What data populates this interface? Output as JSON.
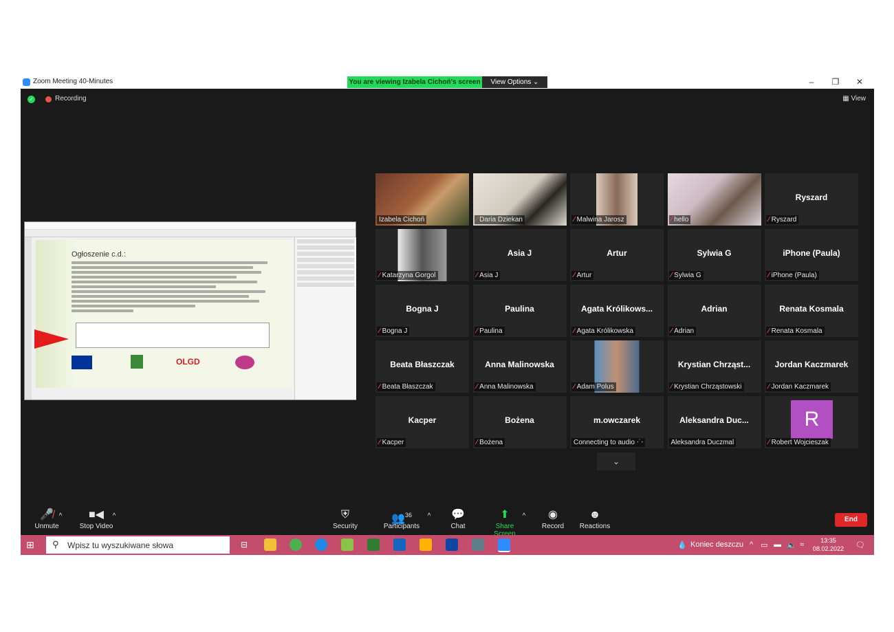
{
  "window": {
    "title": "Zoom Meeting 40-Minutes",
    "viewing_banner": "You are viewing Izabela Cichoń's screen",
    "view_options": "View Options ⌄",
    "minimize": "–",
    "restore": "❐",
    "close": "✕"
  },
  "header": {
    "recording": "Recording",
    "view": "View"
  },
  "shared_screen": {
    "slide_heading": "Ogłoszenie c.d.:",
    "logo_text": "OLGD"
  },
  "tiles": [
    {
      "label": "Izabela Cichoń",
      "muted": false,
      "video": true,
      "active": true
    },
    {
      "label": "Daria Dziekan",
      "muted": true,
      "video": true
    },
    {
      "label": "Malwina Jarosz",
      "muted": true,
      "video": true
    },
    {
      "label": "hello",
      "muted": true,
      "video": true
    },
    {
      "name": "Ryszard",
      "label": "Ryszard",
      "muted": true
    },
    {
      "label": "Katarzyna Gorgol",
      "muted": true,
      "video": true
    },
    {
      "name": "Asia J",
      "label": "Asia J",
      "muted": true
    },
    {
      "name": "Artur",
      "label": "Artur",
      "muted": true
    },
    {
      "name": "Sylwia G",
      "label": "Sylwia G",
      "muted": true
    },
    {
      "name": "iPhone (Paula)",
      "label": "iPhone (Paula)",
      "muted": true
    },
    {
      "name": "Bogna J",
      "label": "Bogna J",
      "muted": true
    },
    {
      "name": "Paulina",
      "label": "Paulina",
      "muted": true
    },
    {
      "name": "Agata Królikows...",
      "label": "Agata Królikowska",
      "muted": true
    },
    {
      "name": "Adrian",
      "label": "Adrian",
      "muted": true
    },
    {
      "name": "Renata Kosmala",
      "label": "Renata Kosmala",
      "muted": true
    },
    {
      "name": "Beata Błaszczak",
      "label": "Beata Błaszczak",
      "muted": true
    },
    {
      "name": "Anna Malinowska",
      "label": "Anna Malinowska",
      "muted": true
    },
    {
      "label": "Adam Polus",
      "muted": true,
      "video": true
    },
    {
      "name": "Krystian Chrząst...",
      "label": "Krystian Chrząstowski",
      "muted": true
    },
    {
      "name": "Jordan Kaczmarek",
      "label": "Jordan Kaczmarek",
      "muted": true
    },
    {
      "name": "Kacper",
      "label": "Kacper",
      "muted": true
    },
    {
      "name": "Bożena",
      "label": "Bożena",
      "muted": true
    },
    {
      "name": "m.owczarek",
      "label": "Connecting to audio ⋅˙⋅",
      "muted": false
    },
    {
      "name": "Aleksandra Duc...",
      "label": "Aleksandra Duczmal",
      "muted": false
    },
    {
      "avatar": "R",
      "label": "Robert Wojcieszak",
      "muted": true
    }
  ],
  "toolbar": {
    "unmute": "Unmute",
    "stop_video": "Stop Video",
    "security": "Security",
    "participants": "Participants",
    "participants_count": "36",
    "chat": "Chat",
    "share_screen": "Share Screen",
    "record": "Record",
    "reactions": "Reactions",
    "end": "End"
  },
  "taskbar": {
    "search_placeholder": "Wpisz tu wyszukiwane słowa",
    "weather": "Koniec deszczu",
    "time": "13:35",
    "date": "08.02.2022"
  },
  "colors": {
    "active_speaker": "#d8f03c",
    "banner_green": "#23d959",
    "end_red": "#e02828",
    "taskbar": "#c44d6e",
    "avatar": "#b24fc2"
  }
}
